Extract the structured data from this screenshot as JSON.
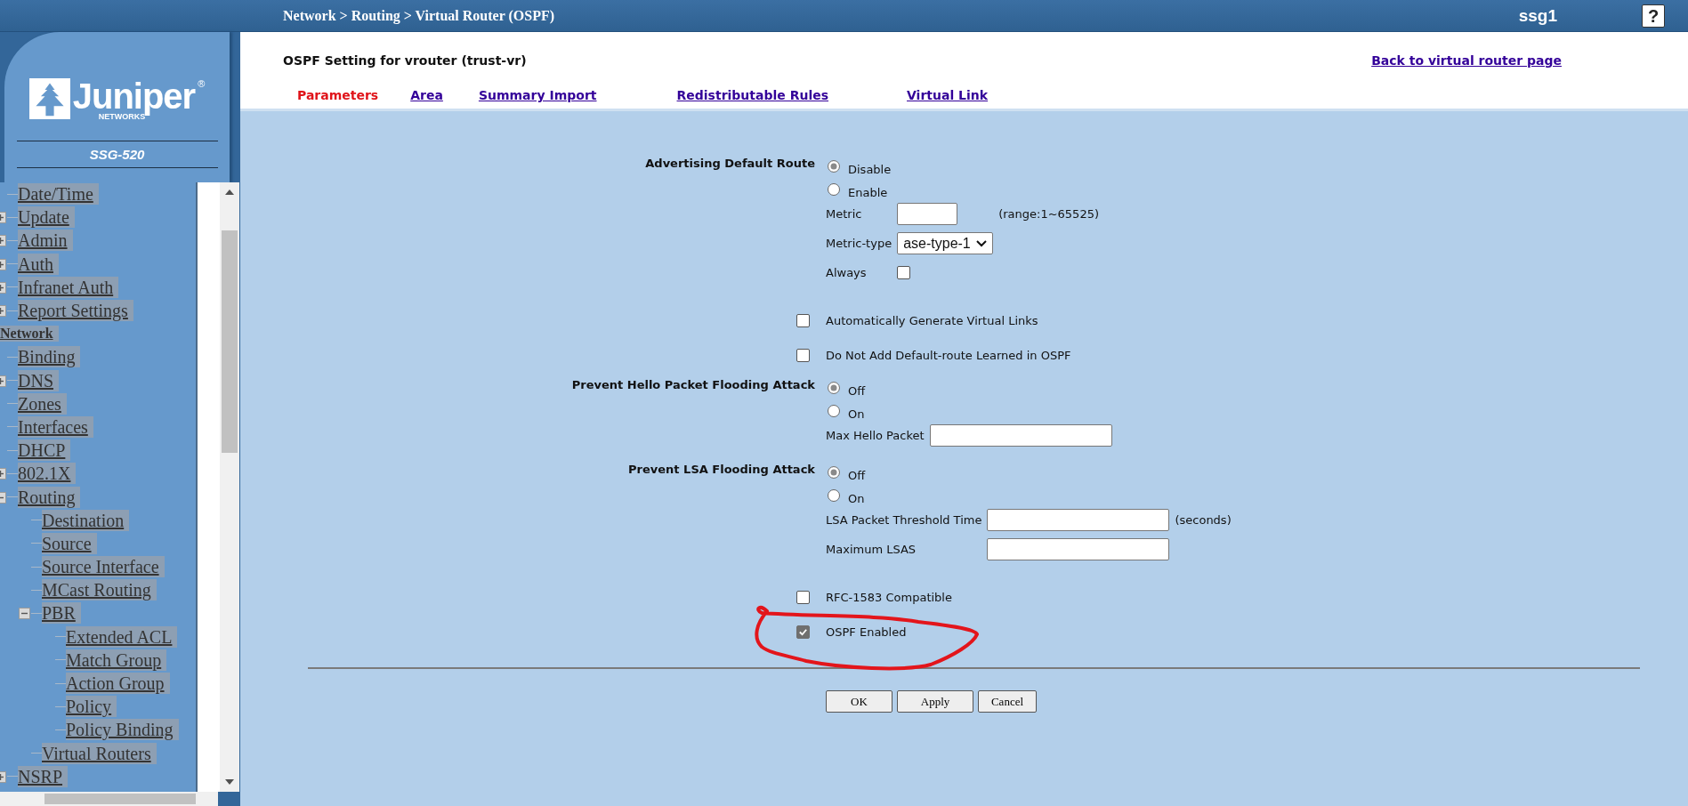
{
  "top_bar": {
    "breadcrumb": "Network > Routing > Virtual Router (OSPF)",
    "device": "ssg1",
    "help": "?"
  },
  "logo": {
    "name": "Juniper",
    "registered": "®",
    "subtitle": "NETWORKS",
    "model": "SSG-520"
  },
  "sidebar": {
    "items": [
      {
        "kind": "page",
        "label": "Date/Time"
      },
      {
        "kind": "page",
        "label": "Update",
        "expanded": false
      },
      {
        "kind": "page",
        "label": "Admin",
        "expanded": false
      },
      {
        "kind": "page",
        "label": "Auth",
        "expanded": false
      },
      {
        "kind": "page",
        "label": "Infranet Auth",
        "expanded": false
      },
      {
        "kind": "page",
        "label": "Report Settings",
        "expanded": false
      },
      {
        "kind": "category",
        "label": "Network",
        "children": [
          {
            "label": "Binding"
          },
          {
            "label": "DNS",
            "expanded": false
          },
          {
            "label": "Zones"
          },
          {
            "label": "Interfaces"
          },
          {
            "label": "DHCP"
          },
          {
            "label": "802.1X",
            "expanded": false
          },
          {
            "label": "Routing",
            "expanded": true,
            "children": [
              {
                "label": "Destination"
              },
              {
                "label": "Source"
              },
              {
                "label": "Source Interface"
              },
              {
                "label": "MCast Routing"
              },
              {
                "label": "PBR",
                "expanded": true,
                "children": [
                  {
                    "label": "Extended ACL"
                  },
                  {
                    "label": "Match Group"
                  },
                  {
                    "label": "Action Group"
                  },
                  {
                    "label": "Policy"
                  },
                  {
                    "label": "Policy Binding"
                  }
                ]
              },
              {
                "label": "Virtual Routers"
              }
            ]
          },
          {
            "label": "NSRP",
            "expanded": false
          }
        ]
      }
    ]
  },
  "header": {
    "title": "OSPF Setting for vrouter (trust-vr)",
    "back_link": "Back to virtual router page"
  },
  "tabs": [
    {
      "label": "Parameters",
      "selected": true
    },
    {
      "label": "Area",
      "selected": false
    },
    {
      "label": "Summary Import",
      "selected": false
    },
    {
      "label": "Redistributable Rules",
      "selected": false
    },
    {
      "label": "Virtual Link",
      "selected": false
    }
  ],
  "form": {
    "rows": [
      {
        "kind": "radio_group",
        "label": "Advertising Default Route",
        "options": [
          {
            "label": "Disable",
            "selected": true
          },
          {
            "label": "Enable",
            "selected": false
          }
        ],
        "fields": [
          {
            "kind": "text",
            "label": "Metric",
            "note": "(range:1~65525)"
          },
          {
            "kind": "select",
            "label": "Metric-type",
            "value": "ase-type-1"
          },
          {
            "kind": "checkbox",
            "label": "Always",
            "checked": false
          }
        ]
      },
      {
        "kind": "checkbox",
        "label": "Automatically Generate Virtual Links",
        "checked": false,
        "circled": false
      },
      {
        "kind": "checkbox",
        "label": "Do Not Add Default-route Learned in OSPF",
        "checked": false,
        "circled": false
      },
      {
        "kind": "radio_group",
        "label": "Prevent Hello Packet Flooding Attack",
        "options": [
          {
            "label": "Off",
            "selected": true
          },
          {
            "label": "On",
            "selected": false
          }
        ],
        "fields": [
          {
            "kind": "text",
            "label": "Max Hello Packet"
          }
        ]
      },
      {
        "kind": "radio_group",
        "label": "Prevent LSA Flooding Attack",
        "options": [
          {
            "label": "Off",
            "selected": true
          },
          {
            "label": "On",
            "selected": false
          }
        ],
        "fields": [
          {
            "kind": "text",
            "label": "LSA Packet Threshold Time",
            "note": "(seconds)"
          },
          {
            "kind": "text",
            "label": "Maximum LSAS"
          }
        ]
      },
      {
        "kind": "checkbox",
        "label": "RFC-1583 Compatible",
        "checked": false,
        "circled": false
      },
      {
        "kind": "checkbox",
        "label": "OSPF Enabled",
        "checked": true,
        "circled": true
      }
    ]
  },
  "buttons": [
    "OK",
    "Apply",
    "Cancel"
  ]
}
